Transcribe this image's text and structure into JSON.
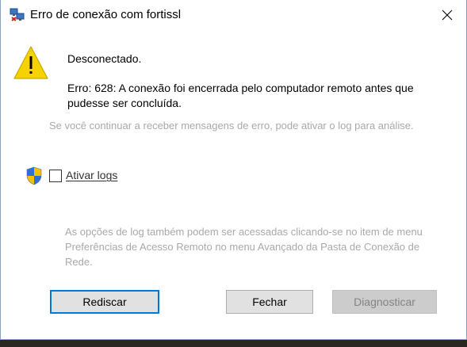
{
  "window": {
    "title": "Erro de conexão com fortissl",
    "close_label": "Fechar janela",
    "colors": {
      "accent": "#0078d7",
      "warning": "#f6d200",
      "muted_text": "#a9a9a9"
    }
  },
  "content": {
    "headline": "Desconectado.",
    "error_message": "Erro: 628: A conexão foi encerrada pelo computador remoto antes que pudesse ser concluída.",
    "hint": "Se você continuar a receber mensagens de erro, pode ativar o log para análise.",
    "logging_checkbox": {
      "label": "Ativar logs",
      "checked": false
    },
    "log_info": "As opções de log também podem ser acessadas clicando-se no item de menu Preferências de Acesso Remoto no menu Avançado da Pasta de Conexão de Rede."
  },
  "buttons": {
    "redial": "Rediscar",
    "close": "Fechar",
    "diagnose": "Diagnosticar"
  },
  "icons": {
    "title": "network-connection-icon",
    "warning": "warning-triangle-icon",
    "shield": "uac-shield-icon",
    "close": "close-icon"
  }
}
